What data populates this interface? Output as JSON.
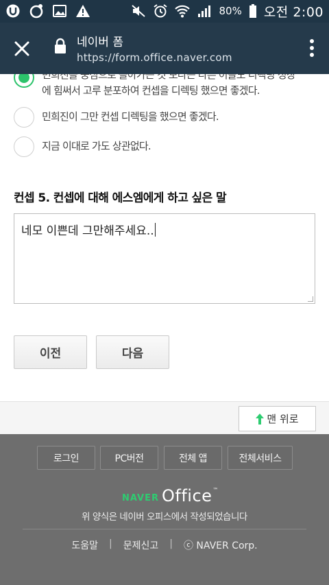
{
  "status_bar": {
    "battery": "80%",
    "time": "오전 2:00",
    "left_icons": [
      "u-app-icon",
      "chat-icon",
      "image-icon",
      "warning-icon"
    ],
    "right_icons": [
      "mute-icon",
      "alarm-icon",
      "wifi-icon",
      "signal-icon",
      "battery-icon"
    ]
  },
  "browser": {
    "title": "네이버 폼",
    "url": "https://form.office.naver.com"
  },
  "form": {
    "options": [
      {
        "text": "민희진을 중심으로 돌아가는 것 보다는 다른 이들도 디렉팅 성장에 힘써서 고루 분포하여 컨셉을 디렉팅 했으면 좋겠다.",
        "checked": true
      },
      {
        "text": "민희진이 그만 컨셉 디렉팅을 했으면 좋겠다.",
        "checked": false
      },
      {
        "text": "지금 이대로 가도 상관없다.",
        "checked": false
      }
    ],
    "question": "컨셉 5. 컨셉에 대해 에스엠에게 하고 싶은 말",
    "answer": "네모 이쁜데 그만해주세요..",
    "prev_label": "이전",
    "next_label": "다음"
  },
  "top_button": {
    "label": "맨 위로"
  },
  "footer": {
    "links": [
      "로그인",
      "PC버전",
      "전체 앱",
      "전체서비스"
    ],
    "logo_naver": "NAVER",
    "logo_office": "Office",
    "made_with": "위 양식은 네이버 오피스에서 작성되었습니다",
    "bottom_links": [
      "도움말",
      "문제신고",
      "ⓒ NAVER Corp."
    ],
    "brand_green": "#2ecc71"
  }
}
